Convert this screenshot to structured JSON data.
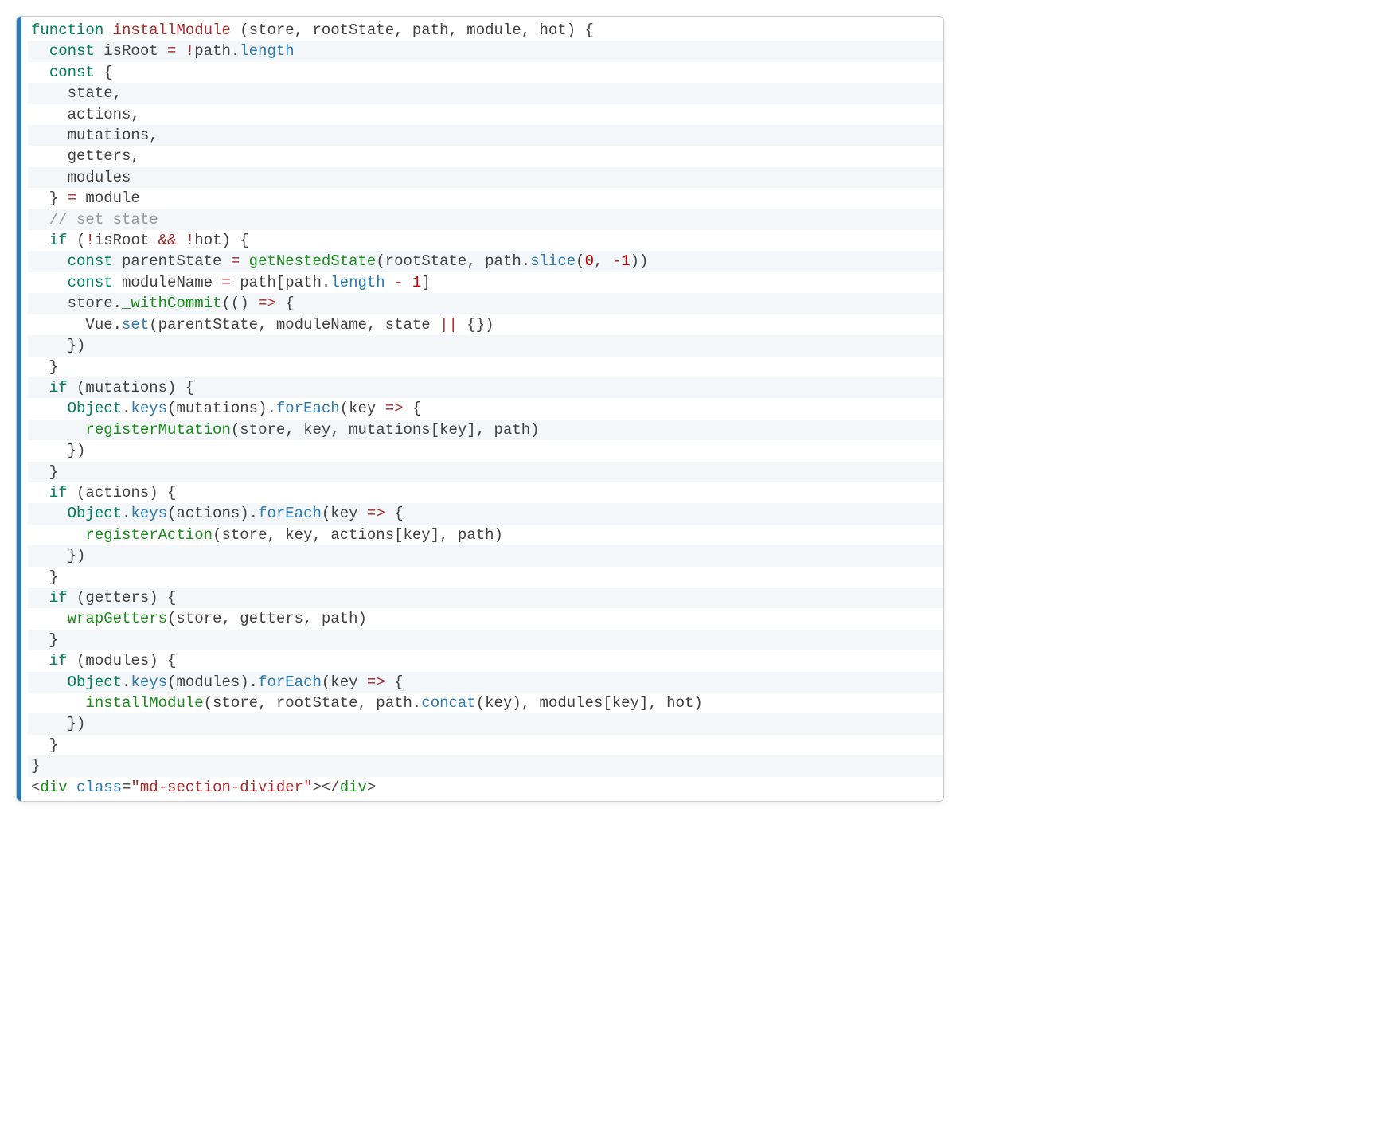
{
  "lines": [
    {
      "stripe": false,
      "tokens": [
        {
          "cls": "kw",
          "t": "function"
        },
        {
          "cls": "",
          "t": " "
        },
        {
          "cls": "fn",
          "t": "installModule"
        },
        {
          "cls": "",
          "t": " (store, rootState, path, module, hot) {"
        }
      ]
    },
    {
      "stripe": true,
      "tokens": [
        {
          "cls": "",
          "t": "  "
        },
        {
          "cls": "kw",
          "t": "const"
        },
        {
          "cls": "",
          "t": " isRoot "
        },
        {
          "cls": "op",
          "t": "="
        },
        {
          "cls": "",
          "t": " "
        },
        {
          "cls": "op",
          "t": "!"
        },
        {
          "cls": "",
          "t": "path."
        },
        {
          "cls": "prop",
          "t": "length"
        }
      ]
    },
    {
      "stripe": false,
      "tokens": [
        {
          "cls": "",
          "t": "  "
        },
        {
          "cls": "kw",
          "t": "const"
        },
        {
          "cls": "",
          "t": " {"
        }
      ]
    },
    {
      "stripe": true,
      "tokens": [
        {
          "cls": "",
          "t": "    state,"
        }
      ]
    },
    {
      "stripe": false,
      "tokens": [
        {
          "cls": "",
          "t": "    actions,"
        }
      ]
    },
    {
      "stripe": true,
      "tokens": [
        {
          "cls": "",
          "t": "    mutations,"
        }
      ]
    },
    {
      "stripe": false,
      "tokens": [
        {
          "cls": "",
          "t": "    getters,"
        }
      ]
    },
    {
      "stripe": true,
      "tokens": [
        {
          "cls": "",
          "t": "    modules"
        }
      ]
    },
    {
      "stripe": false,
      "tokens": [
        {
          "cls": "",
          "t": "  } "
        },
        {
          "cls": "op",
          "t": "="
        },
        {
          "cls": "",
          "t": " module"
        }
      ]
    },
    {
      "stripe": true,
      "tokens": [
        {
          "cls": "",
          "t": "  "
        },
        {
          "cls": "cmt",
          "t": "// set state"
        }
      ]
    },
    {
      "stripe": false,
      "tokens": [
        {
          "cls": "",
          "t": "  "
        },
        {
          "cls": "kw",
          "t": "if"
        },
        {
          "cls": "",
          "t": " ("
        },
        {
          "cls": "op",
          "t": "!"
        },
        {
          "cls": "",
          "t": "isRoot "
        },
        {
          "cls": "op",
          "t": "&&"
        },
        {
          "cls": "",
          "t": " "
        },
        {
          "cls": "op",
          "t": "!"
        },
        {
          "cls": "",
          "t": "hot) {"
        }
      ]
    },
    {
      "stripe": true,
      "tokens": [
        {
          "cls": "",
          "t": "    "
        },
        {
          "cls": "kw",
          "t": "const"
        },
        {
          "cls": "",
          "t": " parentState "
        },
        {
          "cls": "op",
          "t": "="
        },
        {
          "cls": "",
          "t": " "
        },
        {
          "cls": "call",
          "t": "getNestedState"
        },
        {
          "cls": "",
          "t": "(rootState, path."
        },
        {
          "cls": "prop",
          "t": "slice"
        },
        {
          "cls": "",
          "t": "("
        },
        {
          "cls": "num",
          "t": "0"
        },
        {
          "cls": "",
          "t": ", "
        },
        {
          "cls": "op",
          "t": "-"
        },
        {
          "cls": "num",
          "t": "1"
        },
        {
          "cls": "",
          "t": "))"
        }
      ]
    },
    {
      "stripe": false,
      "tokens": [
        {
          "cls": "",
          "t": "    "
        },
        {
          "cls": "kw",
          "t": "const"
        },
        {
          "cls": "",
          "t": " moduleName "
        },
        {
          "cls": "op",
          "t": "="
        },
        {
          "cls": "",
          "t": " path[path."
        },
        {
          "cls": "prop",
          "t": "length"
        },
        {
          "cls": "",
          "t": " "
        },
        {
          "cls": "op",
          "t": "-"
        },
        {
          "cls": "",
          "t": " "
        },
        {
          "cls": "num",
          "t": "1"
        },
        {
          "cls": "",
          "t": "]"
        }
      ]
    },
    {
      "stripe": true,
      "tokens": [
        {
          "cls": "",
          "t": "    store."
        },
        {
          "cls": "call",
          "t": "_withCommit"
        },
        {
          "cls": "",
          "t": "(() "
        },
        {
          "cls": "op",
          "t": "=>"
        },
        {
          "cls": "",
          "t": " {"
        }
      ]
    },
    {
      "stripe": false,
      "tokens": [
        {
          "cls": "",
          "t": "      Vue."
        },
        {
          "cls": "prop",
          "t": "set"
        },
        {
          "cls": "",
          "t": "(parentState, moduleName, state "
        },
        {
          "cls": "op",
          "t": "||"
        },
        {
          "cls": "",
          "t": " {})"
        }
      ]
    },
    {
      "stripe": true,
      "tokens": [
        {
          "cls": "",
          "t": "    })"
        }
      ]
    },
    {
      "stripe": false,
      "tokens": [
        {
          "cls": "",
          "t": "  }"
        }
      ]
    },
    {
      "stripe": true,
      "tokens": [
        {
          "cls": "",
          "t": "  "
        },
        {
          "cls": "kw",
          "t": "if"
        },
        {
          "cls": "",
          "t": " (mutations) {"
        }
      ]
    },
    {
      "stripe": false,
      "tokens": [
        {
          "cls": "",
          "t": "    "
        },
        {
          "cls": "kw",
          "t": "Object"
        },
        {
          "cls": "",
          "t": "."
        },
        {
          "cls": "prop",
          "t": "keys"
        },
        {
          "cls": "",
          "t": "(mutations)."
        },
        {
          "cls": "prop",
          "t": "forEach"
        },
        {
          "cls": "",
          "t": "(key "
        },
        {
          "cls": "op",
          "t": "=>"
        },
        {
          "cls": "",
          "t": " {"
        }
      ]
    },
    {
      "stripe": true,
      "tokens": [
        {
          "cls": "",
          "t": "      "
        },
        {
          "cls": "call",
          "t": "registerMutation"
        },
        {
          "cls": "",
          "t": "(store, key, mutations[key], path)"
        }
      ]
    },
    {
      "stripe": false,
      "tokens": [
        {
          "cls": "",
          "t": "    })"
        }
      ]
    },
    {
      "stripe": true,
      "tokens": [
        {
          "cls": "",
          "t": "  }"
        }
      ]
    },
    {
      "stripe": false,
      "tokens": [
        {
          "cls": "",
          "t": "  "
        },
        {
          "cls": "kw",
          "t": "if"
        },
        {
          "cls": "",
          "t": " (actions) {"
        }
      ]
    },
    {
      "stripe": true,
      "tokens": [
        {
          "cls": "",
          "t": "    "
        },
        {
          "cls": "kw",
          "t": "Object"
        },
        {
          "cls": "",
          "t": "."
        },
        {
          "cls": "prop",
          "t": "keys"
        },
        {
          "cls": "",
          "t": "(actions)."
        },
        {
          "cls": "prop",
          "t": "forEach"
        },
        {
          "cls": "",
          "t": "(key "
        },
        {
          "cls": "op",
          "t": "=>"
        },
        {
          "cls": "",
          "t": " {"
        }
      ]
    },
    {
      "stripe": false,
      "tokens": [
        {
          "cls": "",
          "t": "      "
        },
        {
          "cls": "call",
          "t": "registerAction"
        },
        {
          "cls": "",
          "t": "(store, key, actions[key], path)"
        }
      ]
    },
    {
      "stripe": true,
      "tokens": [
        {
          "cls": "",
          "t": "    })"
        }
      ]
    },
    {
      "stripe": false,
      "tokens": [
        {
          "cls": "",
          "t": "  }"
        }
      ]
    },
    {
      "stripe": true,
      "tokens": [
        {
          "cls": "",
          "t": "  "
        },
        {
          "cls": "kw",
          "t": "if"
        },
        {
          "cls": "",
          "t": " (getters) {"
        }
      ]
    },
    {
      "stripe": false,
      "tokens": [
        {
          "cls": "",
          "t": "    "
        },
        {
          "cls": "call",
          "t": "wrapGetters"
        },
        {
          "cls": "",
          "t": "(store, getters, path)"
        }
      ]
    },
    {
      "stripe": true,
      "tokens": [
        {
          "cls": "",
          "t": "  }"
        }
      ]
    },
    {
      "stripe": false,
      "tokens": [
        {
          "cls": "",
          "t": "  "
        },
        {
          "cls": "kw",
          "t": "if"
        },
        {
          "cls": "",
          "t": " (modules) {"
        }
      ]
    },
    {
      "stripe": true,
      "tokens": [
        {
          "cls": "",
          "t": "    "
        },
        {
          "cls": "kw",
          "t": "Object"
        },
        {
          "cls": "",
          "t": "."
        },
        {
          "cls": "prop",
          "t": "keys"
        },
        {
          "cls": "",
          "t": "(modules)."
        },
        {
          "cls": "prop",
          "t": "forEach"
        },
        {
          "cls": "",
          "t": "(key "
        },
        {
          "cls": "op",
          "t": "=>"
        },
        {
          "cls": "",
          "t": " {"
        }
      ]
    },
    {
      "stripe": false,
      "tokens": [
        {
          "cls": "",
          "t": "      "
        },
        {
          "cls": "call",
          "t": "installModule"
        },
        {
          "cls": "",
          "t": "(store, rootState, path."
        },
        {
          "cls": "prop",
          "t": "concat"
        },
        {
          "cls": "",
          "t": "(key), modules[key], hot)"
        }
      ]
    },
    {
      "stripe": true,
      "tokens": [
        {
          "cls": "",
          "t": "    })"
        }
      ]
    },
    {
      "stripe": false,
      "tokens": [
        {
          "cls": "",
          "t": "  }"
        }
      ]
    },
    {
      "stripe": true,
      "tokens": [
        {
          "cls": "",
          "t": "}"
        }
      ]
    },
    {
      "stripe": false,
      "tokens": [
        {
          "cls": "punct",
          "t": "<"
        },
        {
          "cls": "tag",
          "t": "div"
        },
        {
          "cls": "",
          "t": " "
        },
        {
          "cls": "attr",
          "t": "class"
        },
        {
          "cls": "punct",
          "t": "="
        },
        {
          "cls": "str",
          "t": "\"md-section-divider\""
        },
        {
          "cls": "punct",
          "t": "></"
        },
        {
          "cls": "tag",
          "t": "div"
        },
        {
          "cls": "punct",
          "t": ">"
        }
      ]
    }
  ]
}
